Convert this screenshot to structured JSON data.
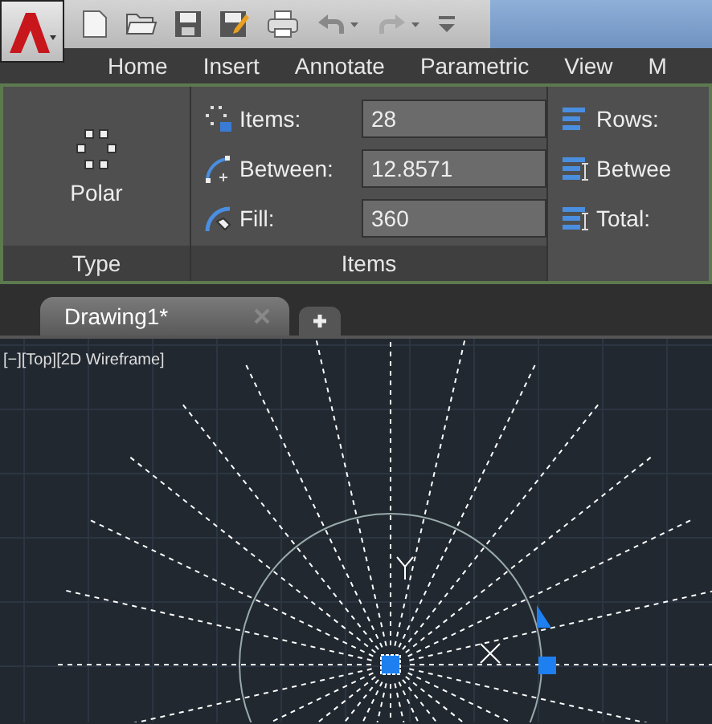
{
  "ribbon_tabs": [
    {
      "label": "Home",
      "selected": false
    },
    {
      "label": "Insert",
      "selected": false
    },
    {
      "label": "Annotate",
      "selected": false
    },
    {
      "label": "Parametric",
      "selected": false
    },
    {
      "label": "View",
      "selected": false
    },
    {
      "label": "M",
      "selected": false
    }
  ],
  "panels": [
    {
      "kind": "type",
      "title": "Type",
      "button": "Polar"
    },
    {
      "kind": "fields",
      "title": "Items",
      "fields": [
        {
          "label": "Items:",
          "value": "28"
        },
        {
          "label": "Between:",
          "value": "12.8571"
        },
        {
          "label": "Fill:",
          "value": "360"
        }
      ]
    },
    {
      "kind": "rows",
      "labels": [
        "Rows:",
        "Betwee",
        "Total:"
      ]
    }
  ],
  "file_tabs": [
    {
      "label": "Drawing1*",
      "selected": true
    }
  ],
  "viewport": {
    "label": "[−][Top][2D Wireframe]"
  }
}
